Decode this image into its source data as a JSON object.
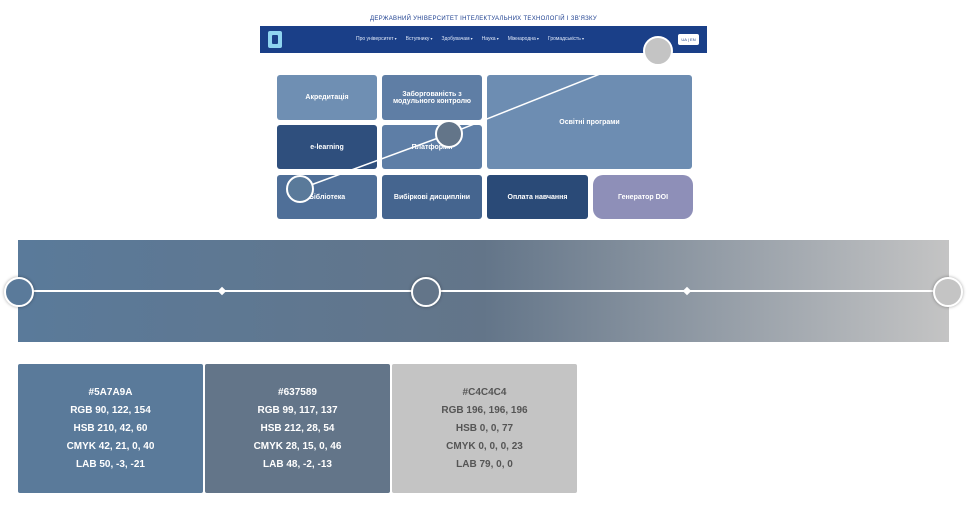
{
  "website": {
    "title": "ДЕРЖАВНИЙ УНІВЕРСИТЕТ ІНТЕЛЕКТУАЛЬНИХ ТЕХНОЛОГІЙ І ЗВ'ЯЗКУ",
    "nav": [
      "Про університет",
      "Вступнику",
      "Здобувачам",
      "Наука",
      "Міжнародна",
      "Громадськість"
    ],
    "lang": "UA | EN",
    "tiles": [
      {
        "label": "Акредитація",
        "color": "#6f8fb3"
      },
      {
        "label": "Заборгованість з модульного контролю",
        "color": "#5f7ea5"
      },
      {
        "label": "Освітні програми",
        "color": "#6d8db2"
      },
      {
        "label": "e-learning",
        "color": "#2f4f7d"
      },
      {
        "label": "Платформи",
        "color": "#5e7ea6"
      },
      {
        "label": "Бібліотека",
        "color": "#4f6f98"
      },
      {
        "label": "Вибіркові дисципліни",
        "color": "#45658f"
      },
      {
        "label": "Оплата навчання",
        "color": "#2a4a77"
      },
      {
        "label": "Генератор DOI",
        "color": "#8e8fb8"
      }
    ]
  },
  "gradient": {
    "stops": [
      {
        "color": "#5A7A9A",
        "position": 0
      },
      {
        "color": "#637589",
        "position": 0.44
      },
      {
        "color": "#C4C4C4",
        "position": 1
      }
    ]
  },
  "swatches": [
    {
      "hex": "#5A7A9A",
      "rgb": "RGB 90, 122, 154",
      "hsb": "HSB 210, 42, 60",
      "cmyk": "CMYK 42, 21, 0, 40",
      "lab": "LAB 50, -3, -21",
      "bg": "#5a7a9a",
      "fg": "#ffffff"
    },
    {
      "hex": "#637589",
      "rgb": "RGB 99, 117, 137",
      "hsb": "HSB 212, 28, 54",
      "cmyk": "CMYK 28, 15, 0, 46",
      "lab": "LAB 48, -2, -13",
      "bg": "#637589",
      "fg": "#ffffff"
    },
    {
      "hex": "#C4C4C4",
      "rgb": "RGB 196, 196, 196",
      "hsb": "HSB 0, 0, 77",
      "cmyk": "CMYK 0, 0, 0, 23",
      "lab": "LAB 79, 0, 0",
      "bg": "#c4c4c4",
      "fg": "#555555"
    }
  ]
}
